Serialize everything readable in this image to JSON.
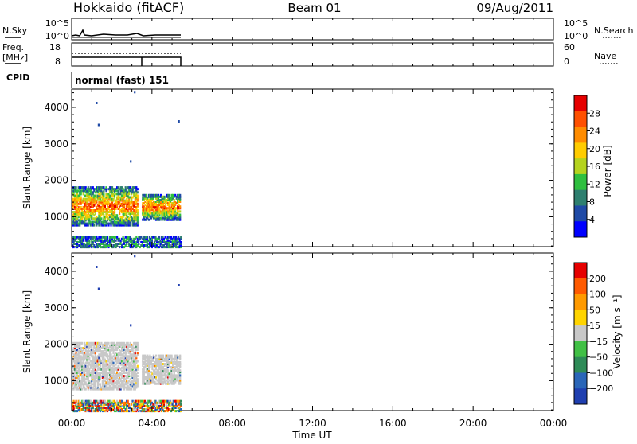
{
  "header": {
    "station": "Hokkaido (fitACF)",
    "beam": "Beam 01",
    "date": "09/Aug/2011"
  },
  "param_panels": {
    "nsky_label": "N.Sky",
    "nsearch_label": "N.Search",
    "freq_label": "Freq.",
    "freq_unit": "[MHz]",
    "nave_label": "Nave",
    "cpid_label": "CPID",
    "cpid_text": "normal (fast) 151",
    "noise_ticks": [
      "10^5",
      "10^0"
    ],
    "freq_ticks": [
      "18",
      "8"
    ],
    "nave_ticks": [
      "60",
      "0"
    ]
  },
  "x_axis": {
    "label": "Time UT",
    "ticks": [
      "00:00",
      "04:00",
      "08:00",
      "12:00",
      "16:00",
      "20:00",
      "00:00"
    ]
  },
  "colors": {
    "power_scale": [
      "#0000ff",
      "#1f4aa6",
      "#2e7f6f",
      "#2fbf3f",
      "#b5d31e",
      "#ffcc00",
      "#ff8c00",
      "#ff5000",
      "#e60000"
    ],
    "velocity_scale": [
      "#1f3fb0",
      "#2a66b8",
      "#2e8b57",
      "#41c045",
      "#c8c8c8",
      "#ffd400",
      "#ff9a00",
      "#ff5a00",
      "#e60000"
    ]
  },
  "chart_data": [
    {
      "type": "heatmap",
      "panel": "power",
      "ylabel": "Slant Range [km]",
      "yticks": [
        "4000",
        "3000",
        "2000",
        "1000"
      ],
      "ylim": [
        180,
        4500
      ],
      "xlim_hours": [
        0,
        24
      ],
      "colorbar_label": "Power [dB]",
      "colorbar_ticks": [
        "28",
        "24",
        "20",
        "16",
        "12",
        "8",
        "4"
      ],
      "data_time_hours": [
        0.0,
        5.4
      ],
      "data_regions": [
        {
          "t": [
            0.0,
            3.3
          ],
          "range": [
            800,
            1850
          ],
          "level": "12-28 dB"
        },
        {
          "t": [
            3.5,
            5.4
          ],
          "range": [
            950,
            1650
          ],
          "level": "8-24 dB"
        },
        {
          "t": [
            0.0,
            5.4
          ],
          "range": [
            200,
            500
          ],
          "level": "4-12 dB"
        }
      ]
    },
    {
      "type": "heatmap",
      "panel": "velocity",
      "ylabel": "Slant Range [km]",
      "yticks": [
        "4000",
        "3000",
        "2000",
        "1000"
      ],
      "ylim": [
        180,
        4500
      ],
      "xlim_hours": [
        0,
        24
      ],
      "colorbar_label": "Velocity [m s⁻¹]",
      "colorbar_ticks": [
        "200",
        "100",
        "50",
        "15",
        "−15",
        "−50",
        "−100",
        "−200"
      ],
      "data_time_hours": [
        0.0,
        5.4
      ],
      "data_regions": [
        {
          "t": [
            0.0,
            3.3
          ],
          "range": [
            800,
            2100
          ],
          "level": "ground scatter (grey)"
        },
        {
          "t": [
            3.5,
            5.4
          ],
          "range": [
            950,
            1750
          ],
          "level": "ground scatter (grey)"
        },
        {
          "t": [
            0.0,
            5.4
          ],
          "range": [
            200,
            500
          ],
          "level": "mixed velocities"
        }
      ]
    }
  ]
}
